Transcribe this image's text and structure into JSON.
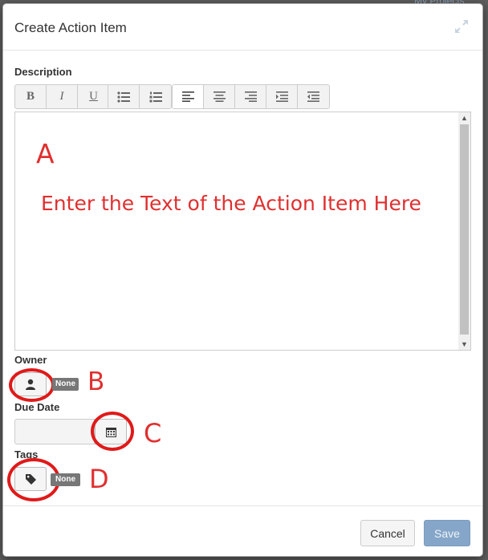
{
  "backdrop": {
    "top_right_text": "My Projects"
  },
  "modal": {
    "title": "Create Action Item"
  },
  "description": {
    "label": "Description",
    "toolbar": {
      "bold": "B",
      "italic": "I",
      "underline": "U"
    },
    "annotation_letter": "A",
    "annotation_text": "Enter the Text of the Action Item Here"
  },
  "owner": {
    "label": "Owner",
    "badge": "None",
    "annotation_letter": "B"
  },
  "due_date": {
    "label": "Due Date",
    "value": "",
    "annotation_letter": "C"
  },
  "tags": {
    "label": "Tags",
    "badge": "None",
    "annotation_letter": "D"
  },
  "footer": {
    "cancel_label": "Cancel",
    "save_label": "Save"
  },
  "colors": {
    "annotation": "#e01a1a",
    "save_button": "#85a6c8",
    "badge": "#777777"
  },
  "icons": [
    "expand-icon",
    "bold-icon",
    "italic-icon",
    "underline-icon",
    "bullet-list-icon",
    "numbered-list-icon",
    "align-left-icon",
    "align-center-icon",
    "align-right-icon",
    "indent-icon",
    "outdent-icon",
    "user-icon",
    "calendar-icon",
    "tag-icon"
  ]
}
